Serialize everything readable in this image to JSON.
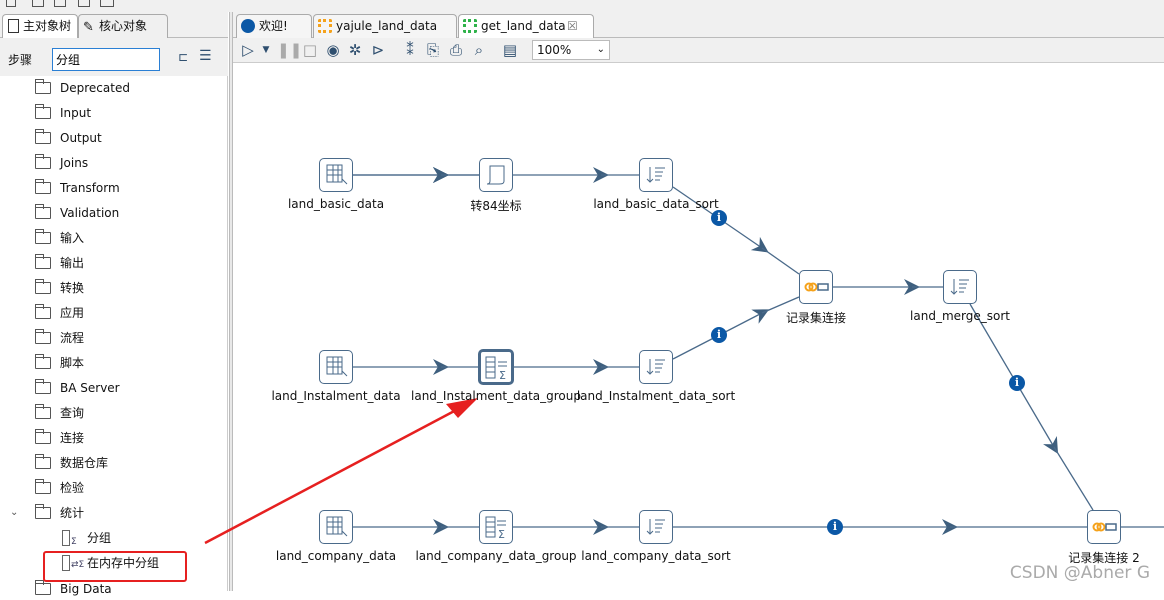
{
  "left_panel": {
    "tabs": [
      {
        "label": "主对象树"
      },
      {
        "label": "核心对象"
      }
    ],
    "step_label": "步骤",
    "search_value": "分组",
    "tree": [
      {
        "label": "Deprecated"
      },
      {
        "label": "Input"
      },
      {
        "label": "Output"
      },
      {
        "label": "Joins"
      },
      {
        "label": "Transform"
      },
      {
        "label": "Validation"
      },
      {
        "label": "输入"
      },
      {
        "label": "输出"
      },
      {
        "label": "转换"
      },
      {
        "label": "应用"
      },
      {
        "label": "流程"
      },
      {
        "label": "脚本"
      },
      {
        "label": "BA Server"
      },
      {
        "label": "查询"
      },
      {
        "label": "连接"
      },
      {
        "label": "数据仓库"
      },
      {
        "label": "检验"
      },
      {
        "label": "统计",
        "expanded": true
      }
    ],
    "stats_children": [
      {
        "label": "分组"
      },
      {
        "label": "在内存中分组",
        "highlighted": true
      }
    ],
    "last_item": "Big Data"
  },
  "editor": {
    "tabs": [
      {
        "label": "欢迎!",
        "color": "#0b58a6"
      },
      {
        "label": "yajule_land_data",
        "color": "#f5a21b"
      },
      {
        "label": "get_land_data",
        "color": "#2fb24a",
        "active": true
      }
    ],
    "zoom": "100%"
  },
  "canvas": {
    "nodes": [
      {
        "label": "land_basic_data",
        "icon": "table-input-icon"
      },
      {
        "label": "转84坐标",
        "icon": "script-icon"
      },
      {
        "label": "land_basic_data_sort",
        "icon": "sort-icon"
      },
      {
        "label": "land_Instalment_data",
        "icon": "table-input-icon"
      },
      {
        "label": "land_Instalment_data_group",
        "icon": "memory-group-by-icon",
        "selected": true
      },
      {
        "label": "land_Instalment_data_sort",
        "icon": "sort-icon"
      },
      {
        "label": "land_company_data",
        "icon": "table-input-icon"
      },
      {
        "label": "land_company_data_group",
        "icon": "memory-group-by-icon"
      },
      {
        "label": "land_company_data_sort",
        "icon": "sort-icon"
      },
      {
        "label": "记录集连接",
        "icon": "merge-join-icon"
      },
      {
        "label": "land_merge_sort",
        "icon": "sort-icon"
      },
      {
        "label": "记录集连接 2",
        "icon": "merge-join-icon"
      }
    ],
    "info_glyph": "i"
  },
  "watermark": "CSDN @Abner G"
}
